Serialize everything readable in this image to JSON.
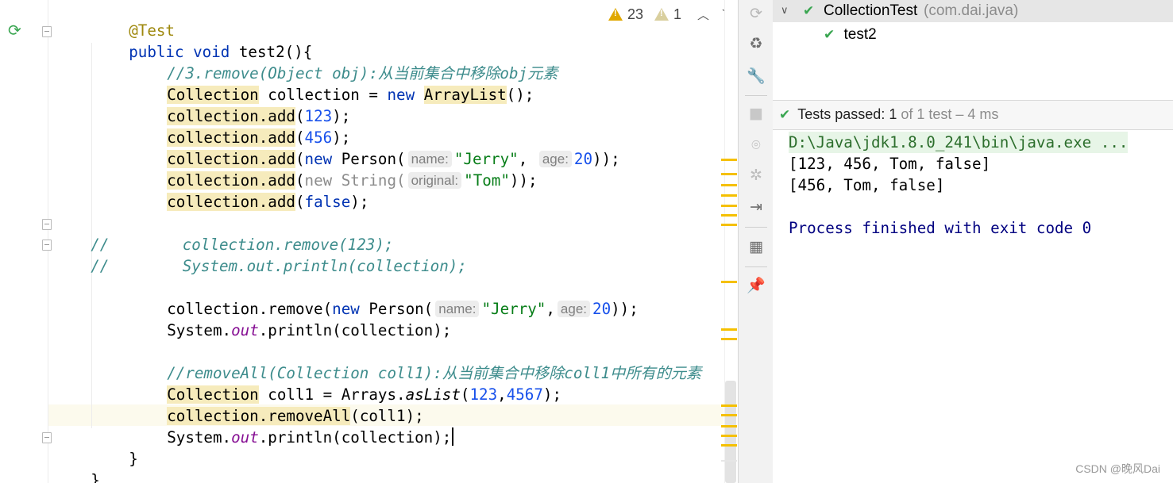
{
  "editor": {
    "inspection": {
      "warnings": "23",
      "weak_warnings": "1"
    },
    "lines": {
      "l1": "@Test",
      "l2_k1": "public",
      "l2_k2": "void",
      "l2_name": "test2(){",
      "l3": "//3.remove(Object obj):从当前集合中移除obj元素",
      "l4_type": "Collection",
      "l4_var": " collection = ",
      "l4_new": "new",
      "l4_cls": "ArrayList",
      "l4_end": "();",
      "l5_m": "collection.add",
      "l5_o": "(",
      "l5_n": "123",
      "l5_e": ");",
      "l6_m": "collection.add",
      "l6_o": "(",
      "l6_n": "456",
      "l6_e": ");",
      "l7_m": "collection.add",
      "l7_o": "(",
      "l7_new": "new",
      "l7_cls": " Person(",
      "l7_h1": "name:",
      "l7_s": "\"Jerry\"",
      "l7_comma": ", ",
      "l7_h2": "age:",
      "l7_n": "20",
      "l7_e": "));",
      "l8_m": "collection.add",
      "l8_o": "(",
      "l8_new": "new String(",
      "l8_h": "original:",
      "l8_s": "\"Tom\"",
      "l8_e": "));",
      "l9_m": "collection.add",
      "l9_o": "(",
      "l9_k": "false",
      "l9_e": ");",
      "l11_p": "//",
      "l11_c": "        collection.remove(123);",
      "l12_p": "//",
      "l12_c": "        System.out.println(collection);",
      "l14_a": "collection.remove(",
      "l14_new": "new",
      "l14_cls": " Person(",
      "l14_h1": "name:",
      "l14_s": "\"Jerry\"",
      "l14_comma": ",",
      "l14_h2": "age:",
      "l14_n": "20",
      "l14_e": "));",
      "l15_a": "System.",
      "l15_f": "out",
      "l15_e": ".println(collection);",
      "l17": "//removeAll(Collection coll1):从当前集合中移除coll1中所有的元素",
      "l18_type": "Collection",
      "l18_a": " coll1 = Arrays.",
      "l18_m": "asList",
      "l18_o": "(",
      "l18_n1": "123",
      "l18_c": ",",
      "l18_n2": "4567",
      "l18_e": ");",
      "l19_m": "collection.removeAll",
      "l19_e": "(coll1);",
      "l20_a": "System.",
      "l20_f": "out",
      "l20_e": ".println(collection);",
      "l21": "}",
      "l22": "}"
    }
  },
  "tool_strip": {
    "icons": [
      "rerun-failed-icon",
      "toggle-auto-test-icon",
      "settings-wrench-icon",
      "stop-icon",
      "snapshot-camera-icon",
      "debug-icon",
      "exit-icon",
      "layout-icon",
      "pin-icon"
    ]
  },
  "run": {
    "tree": {
      "root_name": "CollectionTest",
      "root_pkg": "(com.dai.java)",
      "child_name": "test2"
    },
    "status": {
      "passed_label": "Tests passed:",
      "passed_count": "1",
      "detail": "of 1 test – 4 ms"
    },
    "console": {
      "cmd": "D:\\Java\\jdk1.8.0_241\\bin\\java.exe ...",
      "out1": "[123, 456, Tom, false]",
      "out2": "[456, Tom, false]",
      "exit": "Process finished with exit code 0"
    }
  },
  "watermark": "CSDN @晚风Dai",
  "colors": {
    "keyword": "#0033b3",
    "number": "#1750eb",
    "string": "#067d17",
    "comment": "#3d8c8c",
    "annotation": "#9e880d",
    "field": "#871094",
    "pass_green": "#3aa651",
    "warning": "#e0a800"
  }
}
